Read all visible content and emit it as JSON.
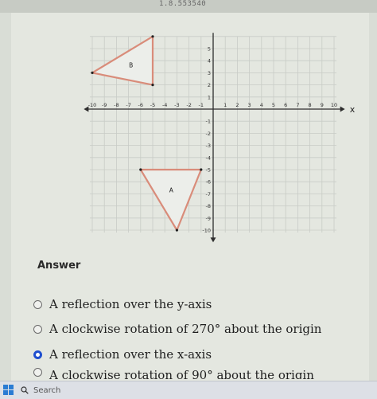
{
  "header": {
    "url_fragment": "1.8.553540"
  },
  "graph": {
    "x_axis_label": "x",
    "x_ticks": [
      "-10",
      "-9",
      "-8",
      "-7",
      "-6",
      "-5",
      "-4",
      "-3",
      "-2",
      "-1",
      "1",
      "2",
      "3",
      "4",
      "5",
      "6",
      "7",
      "8",
      "9",
      "10"
    ],
    "y_ticks": [
      "5",
      "4",
      "3",
      "2",
      "1",
      "-1",
      "-2",
      "-3",
      "-4",
      "-5",
      "-6",
      "-7",
      "-8",
      "-9",
      "-10"
    ],
    "triangle_B": {
      "label": "B",
      "vertices": [
        [
          -10,
          3
        ],
        [
          -5,
          6
        ],
        [
          -5,
          2
        ]
      ]
    },
    "triangle_A": {
      "label": "A",
      "vertices": [
        [
          -6,
          -5
        ],
        [
          -1,
          -5
        ],
        [
          -3,
          -10
        ]
      ]
    },
    "triangle_color": "#d98c7a"
  },
  "answer": {
    "label": "Answer",
    "options": [
      {
        "text": "A reflection over the y-axis",
        "selected": false
      },
      {
        "text": "A clockwise rotation of 270° about the origin",
        "selected": false
      },
      {
        "text": "A reflection over the x-axis",
        "selected": true
      },
      {
        "text": "A clockwise rotation of 90° about the origin",
        "selected": false
      }
    ]
  },
  "taskbar": {
    "search_label": "Search"
  }
}
